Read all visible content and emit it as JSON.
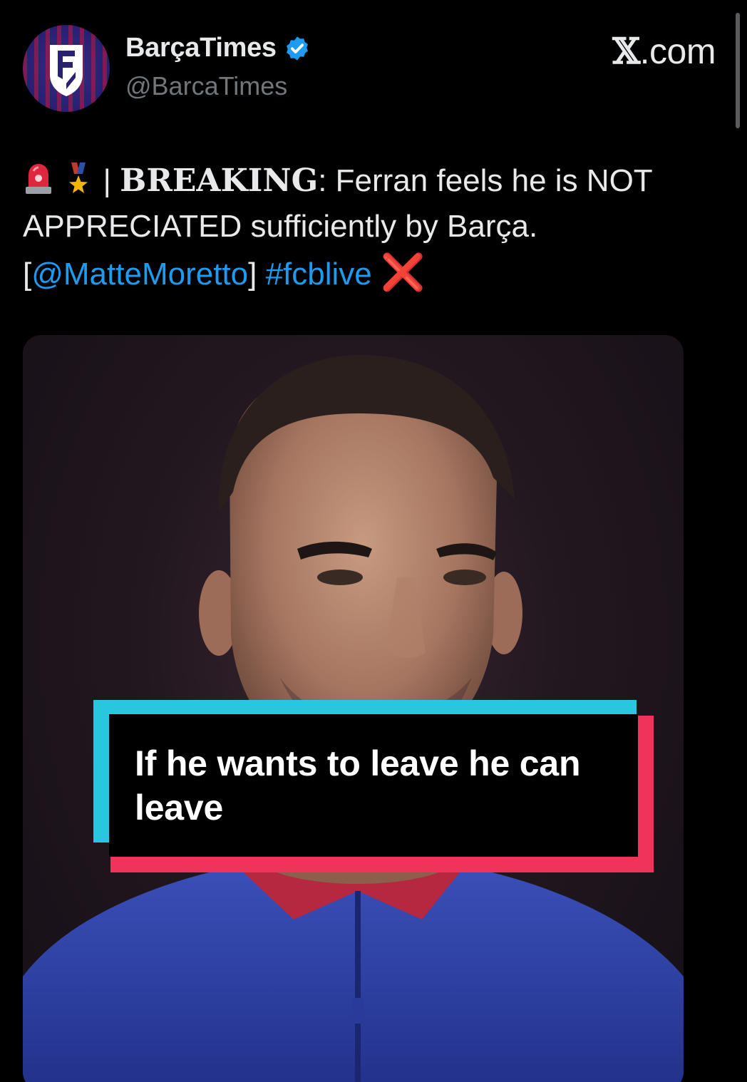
{
  "header": {
    "display_name": "BarçaTimes",
    "handle": "@BarcaTimes",
    "brand_x": "𝕏",
    "brand_suffix": ".com",
    "avatar_icon": "barca-times-shield-logo",
    "verified_icon": "verified-badge-icon"
  },
  "tweet": {
    "emoji_1": "siren-icon",
    "emoji_2": "medal-icon",
    "separator": " | ",
    "breaking_label": "BREAKING",
    "colon": ":",
    "text_main": " Ferran feels he is NOT APPRECIATED sufficiently by Barça.",
    "bracket_open": "[",
    "mention": "@MatteMoretto",
    "bracket_close": "]",
    "hashtag": "#fcblive",
    "end_icon": "❌"
  },
  "caption": {
    "text": "If he wants to leave he can leave"
  },
  "colors": {
    "background": "#000000",
    "link": "#1d9bf0",
    "caption_cyan": "#28c6df",
    "caption_red": "#f0335a",
    "verified": "#1d9bf0"
  }
}
